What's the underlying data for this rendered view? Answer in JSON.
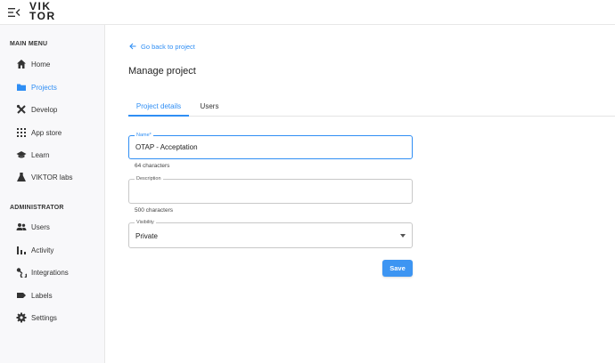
{
  "brand": {
    "logo_line1": "VIK",
    "logo_line2": "TOR"
  },
  "colors": {
    "accent": "#2f8ef4",
    "save_button": "#3d95f2",
    "sidebar_bg": "#f8f8fa"
  },
  "sidebar": {
    "main_menu_title": "MAIN MENU",
    "main_items": [
      {
        "label": "Home",
        "icon": "home-icon"
      },
      {
        "label": "Projects",
        "icon": "folder-icon",
        "active": true
      },
      {
        "label": "Develop",
        "icon": "tools-icon"
      },
      {
        "label": "App store",
        "icon": "grid-icon"
      },
      {
        "label": "Learn",
        "icon": "graduation-cap-icon"
      },
      {
        "label": "VIKTOR labs",
        "icon": "flask-icon"
      }
    ],
    "admin_title": "ADMINISTRATOR",
    "admin_items": [
      {
        "label": "Users",
        "icon": "users-icon"
      },
      {
        "label": "Activity",
        "icon": "bar-chart-icon"
      },
      {
        "label": "Integrations",
        "icon": "integrations-icon"
      },
      {
        "label": "Labels",
        "icon": "label-icon"
      },
      {
        "label": "Settings",
        "icon": "gear-icon"
      }
    ]
  },
  "main": {
    "back_link": "Go back to project",
    "page_title": "Manage project",
    "tabs": [
      {
        "label": "Project details",
        "active": true
      },
      {
        "label": "Users"
      }
    ],
    "form": {
      "name_label": "Name*",
      "name_value": "OTAP - Acceptation",
      "name_helper": "64 characters",
      "description_label": "Description",
      "description_value": "",
      "description_helper": "500 characters",
      "visibility_label": "Visibility",
      "visibility_value": "Private",
      "save_label": "Save"
    }
  }
}
